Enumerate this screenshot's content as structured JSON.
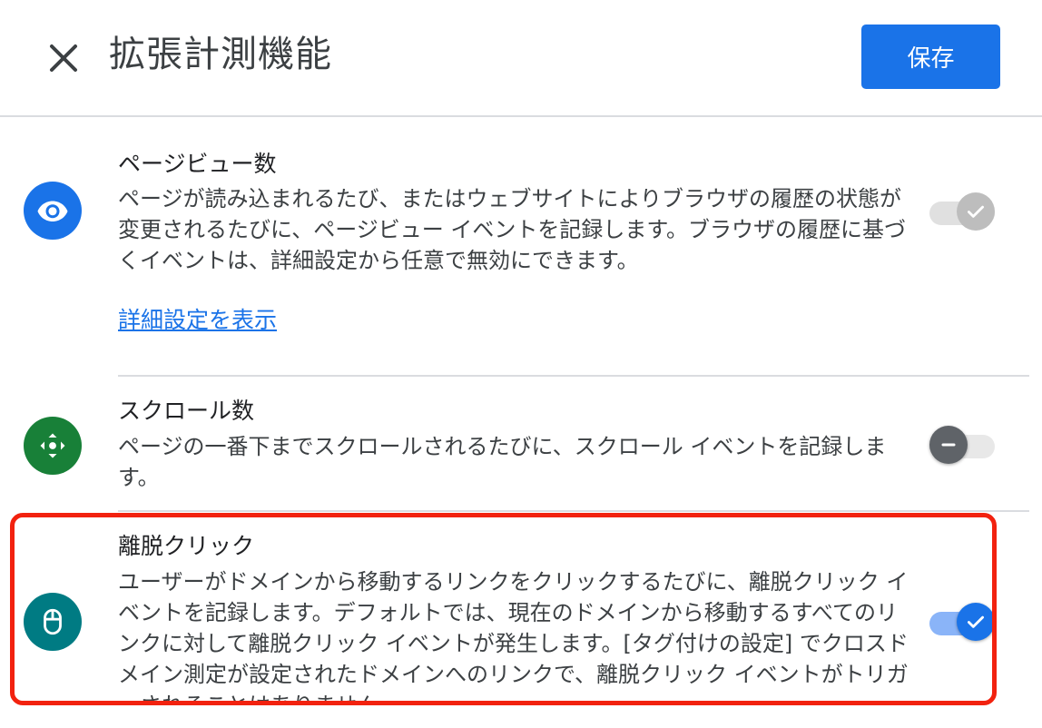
{
  "header": {
    "title": "拡張計測機能",
    "save_label": "保存"
  },
  "sections": [
    {
      "title": "ページビュー数",
      "description": "ページが読み込まれるたび、またはウェブサイトによりブラウザの履歴の状態が変更されるたびに、ページビュー イベントを記録します。ブラウザの履歴に基づくイベントは、詳細設定から任意で無効にできます。",
      "link": "詳細設定を表示",
      "icon": "eye-icon",
      "icon_color": "#1a73e8",
      "toggle_state": "on-disabled"
    },
    {
      "title": "スクロール数",
      "description": "ページの一番下までスクロールされるたびに、スクロール イベントを記録します。",
      "icon": "scroll-icon",
      "icon_color": "#188038",
      "toggle_state": "off"
    },
    {
      "title": "離脱クリック",
      "description": "ユーザーがドメインから移動するリンクをクリックするたびに、離脱クリック イベントを記録します。デフォルトでは、現在のドメインから移動するすべてのリンクに対して離脱クリック イベントが発生します。[タグ付けの設定] でクロスドメイン測定が設定されたドメインへのリンクで、離脱クリック イベントがトリガーされることはありません。",
      "icon": "mouse-icon",
      "icon_color": "#007b83",
      "toggle_state": "on",
      "highlight_color": "#f2220f"
    }
  ],
  "colors": {
    "accent": "#1a73e8",
    "divider": "#dadce0"
  }
}
